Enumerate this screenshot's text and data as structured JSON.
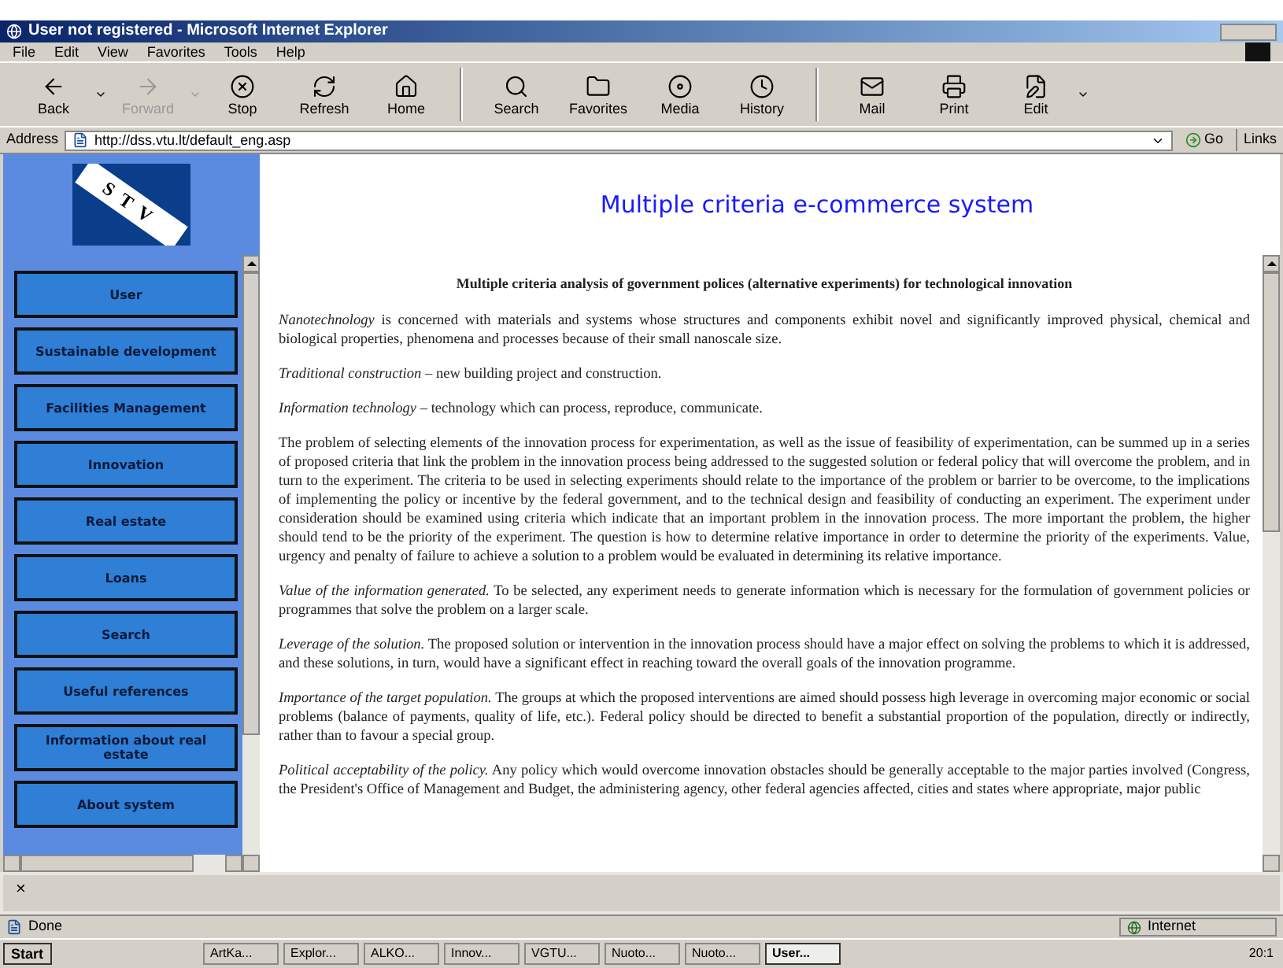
{
  "window": {
    "title": "User not registered - Microsoft Internet Explorer"
  },
  "menu": [
    "File",
    "Edit",
    "View",
    "Favorites",
    "Tools",
    "Help"
  ],
  "toolbar": [
    {
      "kind": "button",
      "label": "Back",
      "disabled": false,
      "dropdown": true
    },
    {
      "kind": "button",
      "label": "Forward",
      "disabled": true,
      "dropdown": true
    },
    {
      "kind": "button",
      "label": "Stop",
      "disabled": false,
      "dropdown": false
    },
    {
      "kind": "button",
      "label": "Refresh",
      "disabled": false,
      "dropdown": false
    },
    {
      "kind": "button",
      "label": "Home",
      "disabled": false,
      "dropdown": false
    },
    {
      "kind": "separator"
    },
    {
      "kind": "button",
      "label": "Search",
      "disabled": false,
      "dropdown": false
    },
    {
      "kind": "button",
      "label": "Favorites",
      "disabled": false,
      "dropdown": false
    },
    {
      "kind": "button",
      "label": "Media",
      "disabled": false,
      "dropdown": false
    },
    {
      "kind": "button",
      "label": "History",
      "disabled": false,
      "dropdown": false
    },
    {
      "kind": "separator"
    },
    {
      "kind": "button",
      "label": "Mail",
      "disabled": false,
      "dropdown": false
    },
    {
      "kind": "button",
      "label": "Print",
      "disabled": false,
      "dropdown": false
    },
    {
      "kind": "button",
      "label": "Edit",
      "disabled": false,
      "dropdown": true
    }
  ],
  "address": {
    "label": "Address",
    "url": "http://dss.vtu.lt/default_eng.asp",
    "go": "Go",
    "links": "Links"
  },
  "sidebar": {
    "logo": "STV",
    "items": [
      "User",
      "Sustainable development",
      "Facilities Management",
      "Innovation",
      "Real estate",
      "Loans",
      "Search",
      "Useful references",
      "Information about real estate",
      "About system"
    ]
  },
  "page": {
    "title": "Multiple criteria e-commerce system",
    "heading": "Multiple criteria analysis of government polices (alternative experiments) for technological innovation",
    "paragraphs": [
      "*Nanotechnology* is concerned with materials and systems whose structures and components exhibit novel and significantly improved physical, chemical and biological properties, phenomena and processes because of their small nanoscale size.",
      "*Traditional construction* – new building project and construction.",
      "*Information technology* – technology which can process, reproduce, communicate.",
      "The problem of selecting elements of the innovation process for experimentation, as well as the issue of feasibility of experimentation, can be summed up in a series of proposed criteria that link the problem in the innovation process being addressed to the suggested solution or federal policy that will overcome the problem, and in turn to the experiment. The criteria to be used in selecting experiments should relate to the importance of the problem or barrier to be overcome, to the implications of implementing the policy or incentive by the federal government, and to the technical design and feasibility of conducting an experiment. The experiment under consideration should be examined using criteria which indicate that an important problem in the innovation process. The more important the problem, the higher should tend to be the priority of the experiment. The question is how to determine relative importance in order to determine the priority of the experiments. Value, urgency and penalty of failure to achieve a solution to a problem would be evaluated in determining its relative importance.",
      "*Value of the information generated.* To be selected, any experiment needs to generate information which is necessary for the formulation of government policies or programmes that solve the problem on a larger scale.",
      "*Leverage of the solution.* The proposed solution or intervention in the innovation process should have a major effect on solving the problems to which it is addressed, and these solutions, in turn, would have a significant effect in reaching toward the overall goals of the innovation programme.",
      "*Importance of the target population.* The groups at which the proposed interventions are aimed should possess high leverage in overcoming major economic or social problems (balance of payments, quality of life, etc.). Federal policy should be directed to benefit a substantial proportion of the population, directly or indirectly, rather than to favour a special group.",
      "*Political acceptability of the policy.* Any policy which would overcome innovation obstacles should be generally acceptable to the major parties involved (Congress, the President's Office of Management and Budget, the administering agency, other federal agencies affected, cities and states where appropriate, major public"
    ]
  },
  "bottom_frame": {
    "close": "×"
  },
  "status_bar": {
    "text": "Done",
    "zone": "Internet"
  },
  "taskbar": {
    "start": "Start",
    "tasks": [
      {
        "label": "ArtKa...",
        "selected": false
      },
      {
        "label": "Explor...",
        "selected": false
      },
      {
        "label": "ALKO...",
        "selected": false
      },
      {
        "label": "Innov...",
        "selected": false
      },
      {
        "label": "VGTU...",
        "selected": false
      },
      {
        "label": "Nuoto...",
        "selected": false
      },
      {
        "label": "Nuoto...",
        "selected": false
      },
      {
        "label": "User...",
        "selected": true
      }
    ],
    "clock": "20:1"
  }
}
